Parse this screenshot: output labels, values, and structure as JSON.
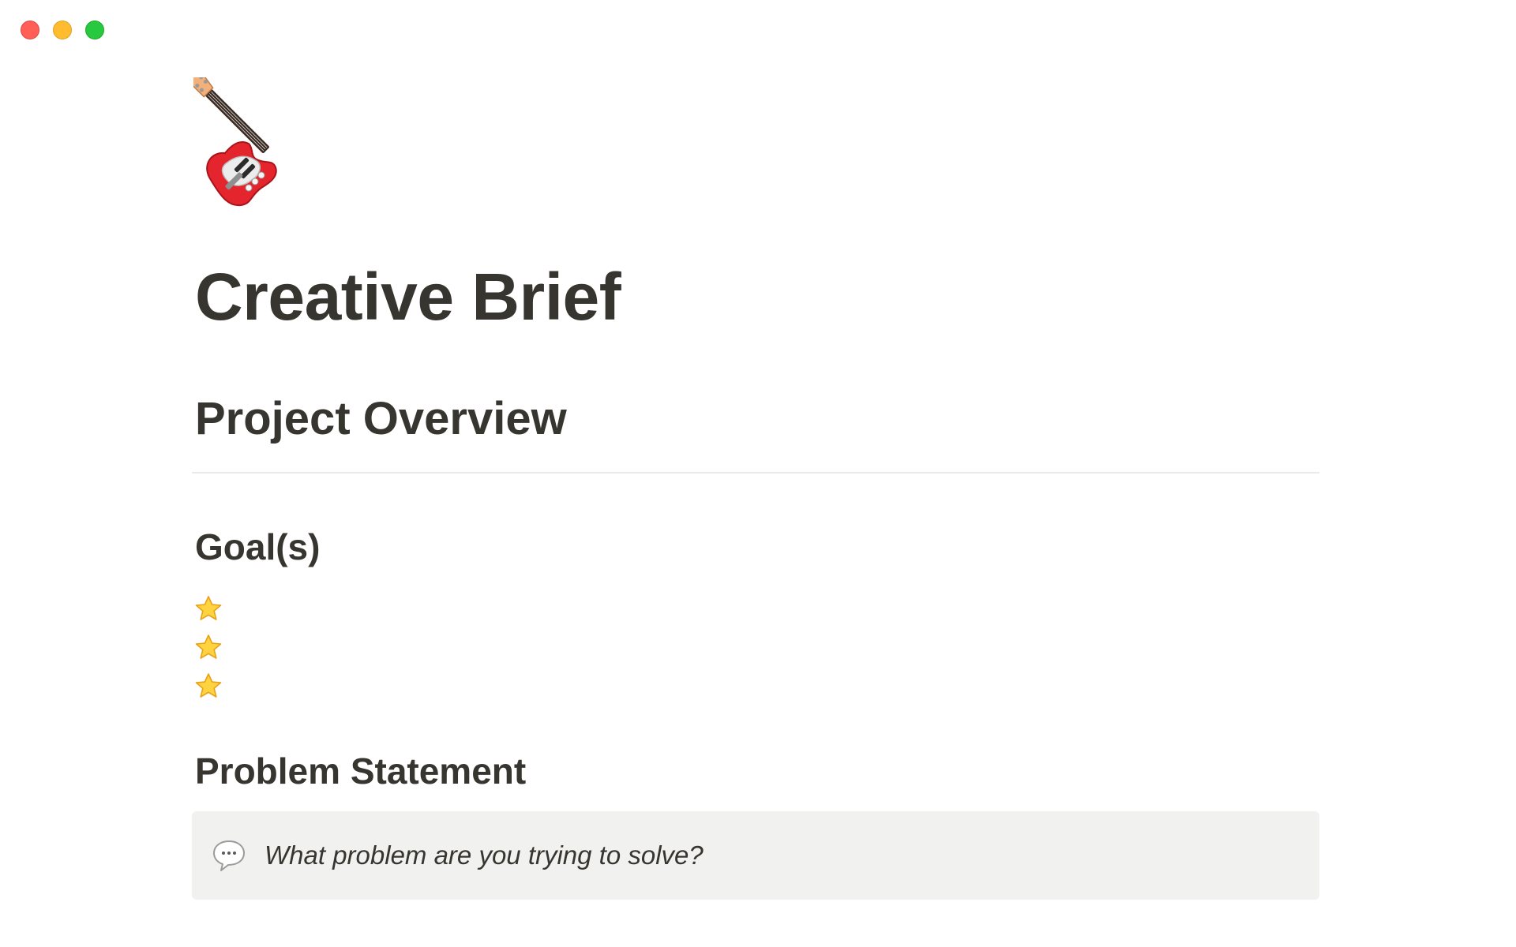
{
  "window": {
    "controls": [
      "close",
      "minimize",
      "zoom"
    ]
  },
  "page": {
    "icon": "electric-guitar-icon",
    "title": "Creative Brief"
  },
  "sections": {
    "overview_heading": "Project Overview",
    "goals_heading": "Goal(s)",
    "goals": [
      {
        "icon": "star-icon",
        "text": ""
      },
      {
        "icon": "star-icon",
        "text": ""
      },
      {
        "icon": "star-icon",
        "text": ""
      }
    ],
    "problem_heading": "Problem Statement",
    "problem_callout": {
      "icon": "speech-bubble-icon",
      "text": "What problem are you trying to solve?"
    }
  },
  "colors": {
    "text": "#37352f",
    "callout_bg": "#f1f1ef",
    "divider": "#e9e9e7",
    "close": "#ff5f57",
    "minimize": "#febc2e",
    "zoom": "#28c840"
  }
}
